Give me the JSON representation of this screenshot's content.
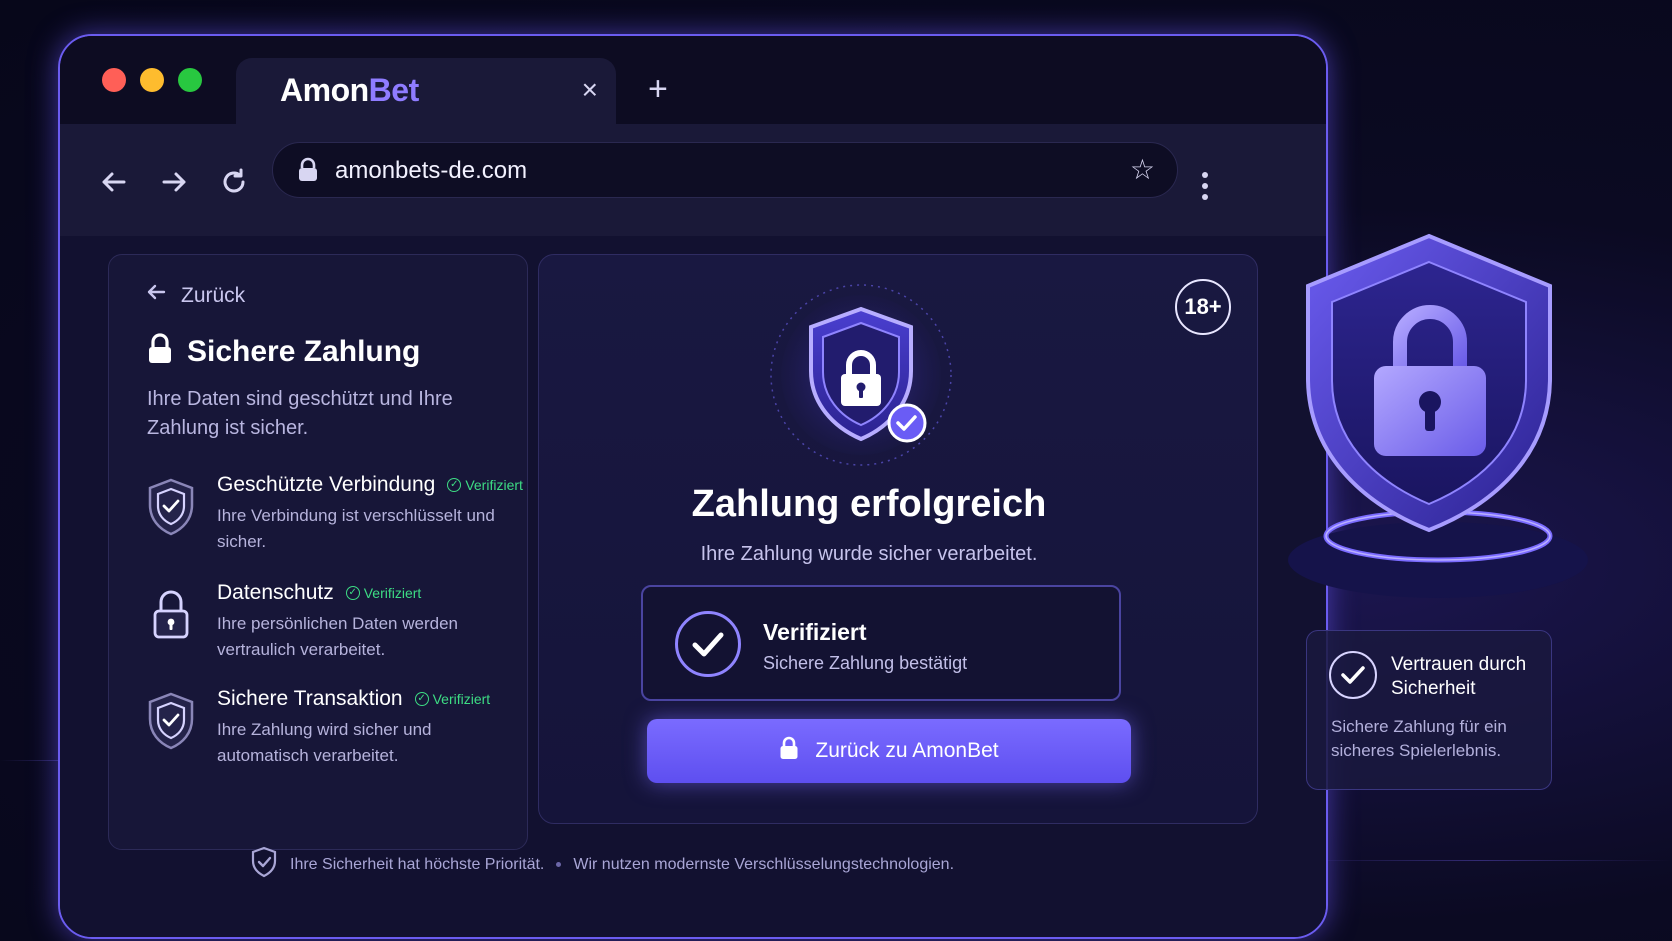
{
  "browser": {
    "tab": {
      "brand_part1": "Amon",
      "brand_part2": "Bet",
      "close_glyph": "×"
    },
    "new_tab_glyph": "+",
    "url": "amonbets-de.com"
  },
  "left_panel": {
    "back_label": "Zurück",
    "title": "Sichere Zahlung",
    "subtitle": "Ihre Daten sind geschützt und Ihre Zahlung ist sicher.",
    "features": [
      {
        "name": "Geschützte Verbindung",
        "badge": "Verifiziert",
        "desc": "Ihre Verbindung ist verschlüsselt und sicher.",
        "icon": "shield-check-icon"
      },
      {
        "name": "Datenschutz",
        "badge": "Verifiziert",
        "desc": "Ihre persönlichen Daten werden vertraulich verarbeitet.",
        "icon": "padlock-icon"
      },
      {
        "name": "Sichere Transaktion",
        "badge": "Verifiziert",
        "desc": "Ihre Zahlung wird sicher und automatisch verarbeitet.",
        "icon": "shield-check-icon"
      }
    ]
  },
  "main_panel": {
    "age_badge": "18+",
    "title": "Zahlung erfolgreich",
    "subtitle": "Ihre Zahlung wurde sicher verarbeitet.",
    "verify_card": {
      "title": "Verifiziert",
      "subtitle": "Sichere Zahlung bestätigt"
    },
    "cta_label": "Zurück zu AmonBet"
  },
  "footer": {
    "note1": "Ihre Sicherheit hat höchste Priorität.",
    "note2": "Wir nutzen modernste Verschlüsselungstechnologien."
  },
  "trust_card": {
    "title": "Vertrauen durch Sicherheit",
    "subtitle": "Sichere Zahlung für ein sicheres Spielerlebnis."
  },
  "colors": {
    "accent": "#7a6bff",
    "verified_green": "#3ddc84",
    "background": "#0b0a22"
  }
}
